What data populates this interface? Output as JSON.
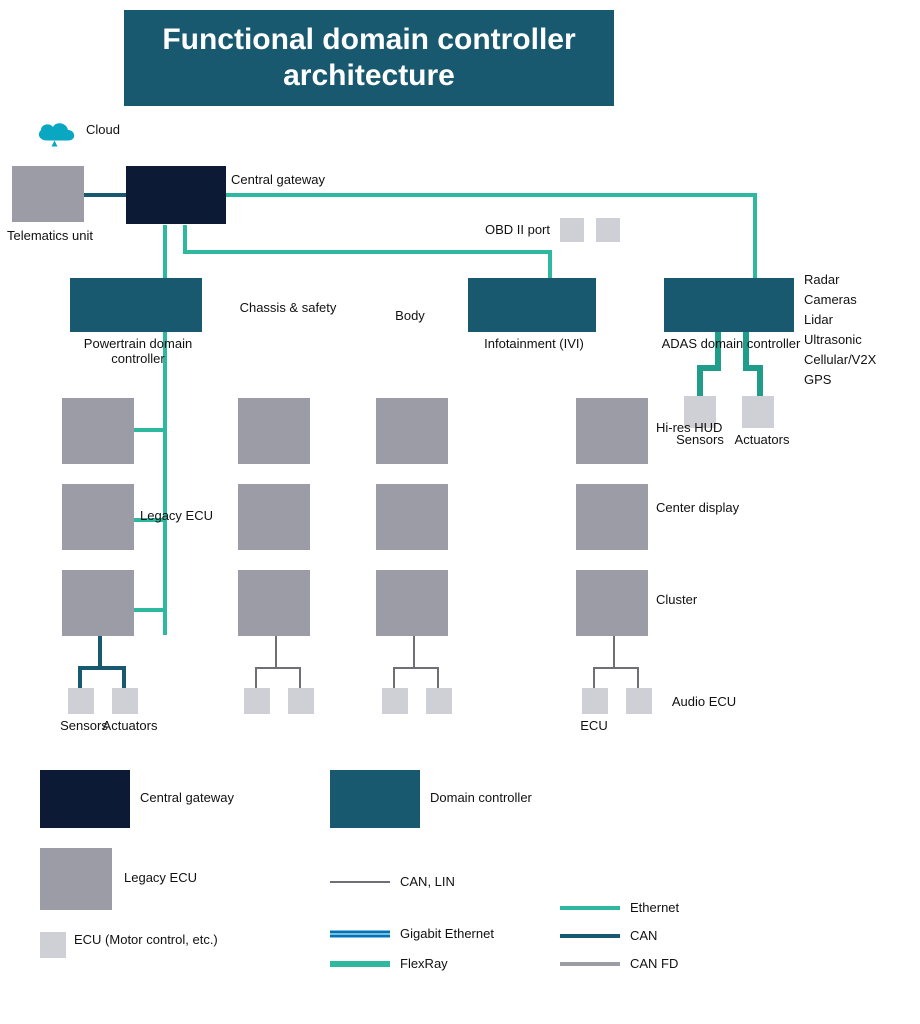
{
  "title": "Functional domain controller architecture",
  "nodes": {
    "telematics": "Telematics unit",
    "central_gw": "Central gateway",
    "cloud": "Cloud",
    "obd": "OBD II port",
    "ecu_small": "ECU",
    "dc_ptrain": "Powertrain domain controller",
    "dc_chassis": "Chassis & safety",
    "dc_body": "Body",
    "dc_ivi": "Infotainment (IVI)",
    "dc_adas": "ADAS domain controller",
    "sens": "Sensors",
    "act": "Actuators",
    "radar": "Radar",
    "cam": "Cameras",
    "lidar": "Lidar",
    "ultra": "Ultrasonic",
    "cell": "Cellular/V2X",
    "gps": "GPS",
    "hud": "Hi-res HUD",
    "display": "Center display",
    "cluster": "Cluster",
    "ecu_label": "Legacy ECU",
    "audio": "Audio ECU"
  },
  "legend": {
    "central_gw": "Central gateway",
    "domain_ctrl": "Domain controller",
    "legacy_ecu": "Legacy ECU",
    "ecu": "ECU (Motor control, etc.)",
    "can_lin": "CAN, LIN",
    "gig_eth": "Gigabit Ethernet",
    "eth": "Ethernet",
    "can": "CAN",
    "flexray": "FlexRay",
    "can_fd": "CAN FD"
  },
  "colors": {
    "navy": "#0c1a36",
    "teal_box": "#18596f",
    "gray": "#9c9ca6",
    "light_gray": "#cfcfd6",
    "ethernet": "#2fb8a0",
    "can": "#18596f",
    "gig": "#0074b8",
    "flexray": "#2fb8a0",
    "canfd": "#9c9ca6"
  }
}
